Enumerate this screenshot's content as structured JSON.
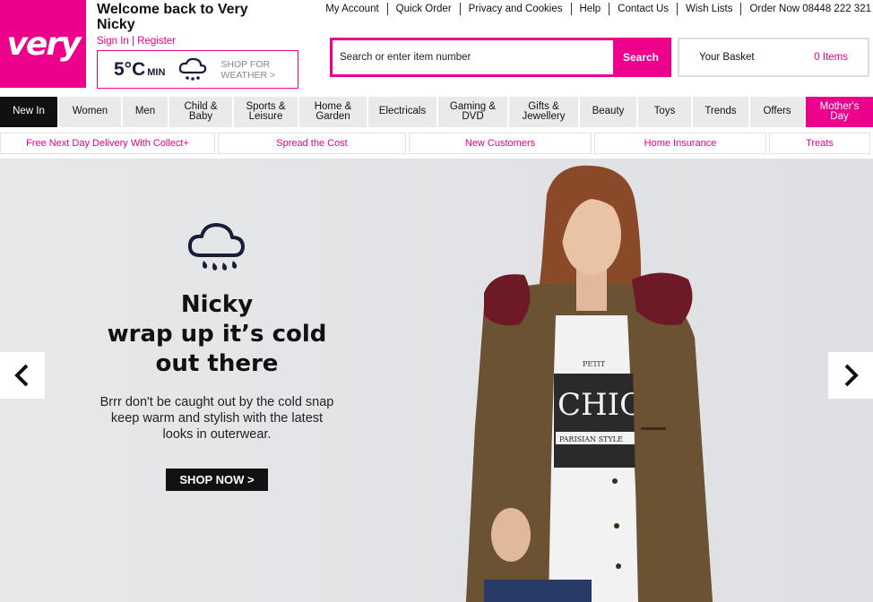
{
  "header": {
    "logo_text": "very",
    "welcome_line1": "Welcome back to Very",
    "welcome_line2": "Nicky",
    "sign_in": "Sign In",
    "separator": "|",
    "register": "Register"
  },
  "weather": {
    "temp": "5°C",
    "min_label": "MIN",
    "shop_line1": "SHOP FOR",
    "shop_line2": "WEATHER >",
    "icon": "rain-cloud-icon"
  },
  "top_links": [
    "My Account",
    "Quick Order",
    "Privacy and Cookies",
    "Help",
    "Contact Us",
    "Wish Lists",
    "Order Now 08448 222 321"
  ],
  "search": {
    "placeholder": "Search or enter item number",
    "button": "Search"
  },
  "basket": {
    "label": "Your Basket",
    "count": "0 Items"
  },
  "nav": [
    {
      "l1": "New In",
      "l2": ""
    },
    {
      "l1": "Women",
      "l2": ""
    },
    {
      "l1": "Men",
      "l2": ""
    },
    {
      "l1": "Child &",
      "l2": "Baby"
    },
    {
      "l1": "Sports &",
      "l2": "Leisure"
    },
    {
      "l1": "Home &",
      "l2": "Garden"
    },
    {
      "l1": "Electricals",
      "l2": ""
    },
    {
      "l1": "Gaming &",
      "l2": "DVD"
    },
    {
      "l1": "Gifts &",
      "l2": "Jewellery"
    },
    {
      "l1": "Beauty",
      "l2": ""
    },
    {
      "l1": "Toys",
      "l2": ""
    },
    {
      "l1": "Trends",
      "l2": ""
    },
    {
      "l1": "Offers",
      "l2": ""
    },
    {
      "l1": "Mother's",
      "l2": "Day"
    }
  ],
  "promos": [
    "Free Next Day Delivery With Collect+",
    "Spread the Cost",
    "New Customers",
    "Home Insurance",
    "Treats"
  ],
  "hero": {
    "headline_1": "Nicky",
    "headline_2": "wrap up it’s cold",
    "headline_3": "out there",
    "sub_1": "Brrr don't be caught out by the cold snap",
    "sub_2": "keep warm and stylish with the latest",
    "sub_3": "looks in outerwear.",
    "cta": "SHOP NOW >",
    "tee_text_1": "PETIT",
    "tee_text_2": "CHIC",
    "tee_text_3": "PARISIAN STYLE",
    "icon": "rain-cloud-icon"
  },
  "colors": {
    "brand_pink": "#ec008c",
    "nav_grey": "#eaeaea",
    "navy": "#1b1b3a"
  }
}
